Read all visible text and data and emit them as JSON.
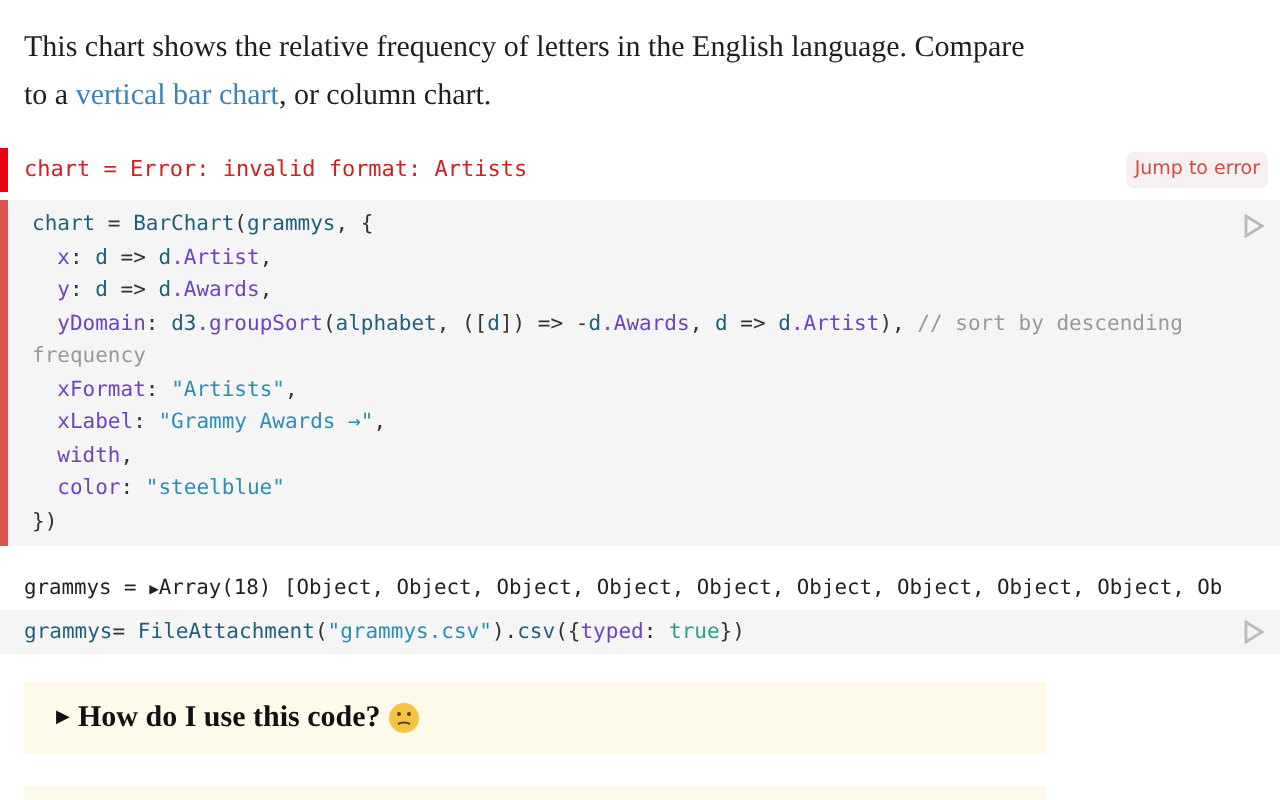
{
  "intro": {
    "text_before": "This chart shows the relative frequency of letters in the English language. Compare to a",
    "link": "vertical bar chart",
    "text_after": ", or column chart."
  },
  "error_cell": {
    "message": "chart = Error: invalid format: Artists",
    "button": "Jump to error"
  },
  "code_cell": {
    "has_error": true,
    "lines": [
      {
        "indent": false,
        "tokens": [
          {
            "kind": "var",
            "text": "chart"
          },
          {
            "kind": "plain",
            "text": " = "
          },
          {
            "kind": "fn",
            "text": "BarChart"
          },
          {
            "kind": "plain",
            "text": "("
          },
          {
            "kind": "fn",
            "text": "grammys"
          },
          {
            "kind": "plain",
            "text": ", {"
          }
        ]
      },
      {
        "indent": true,
        "tokens": [
          {
            "kind": "prop",
            "text": "x"
          },
          {
            "kind": "plain",
            "text": ": "
          },
          {
            "kind": "var",
            "text": "d"
          },
          {
            "kind": "plain",
            "text": " => "
          },
          {
            "kind": "var",
            "text": "d"
          },
          {
            "kind": "prop",
            "text": ".Artist"
          },
          {
            "kind": "plain",
            "text": ","
          }
        ]
      },
      {
        "indent": true,
        "tokens": [
          {
            "kind": "prop",
            "text": "y"
          },
          {
            "kind": "plain",
            "text": ": "
          },
          {
            "kind": "var",
            "text": "d"
          },
          {
            "kind": "plain",
            "text": " => "
          },
          {
            "kind": "var",
            "text": "d"
          },
          {
            "kind": "prop",
            "text": ".Awards"
          },
          {
            "kind": "plain",
            "text": ","
          }
        ]
      },
      {
        "indent": true,
        "tokens": [
          {
            "kind": "prop",
            "text": "yDomain"
          },
          {
            "kind": "plain",
            "text": ": "
          },
          {
            "kind": "var",
            "text": "d3"
          },
          {
            "kind": "prop",
            "text": ".groupSort"
          },
          {
            "kind": "plain",
            "text": "("
          },
          {
            "kind": "var",
            "text": "alphabet"
          },
          {
            "kind": "plain",
            "text": ", (["
          },
          {
            "kind": "var",
            "text": "d"
          },
          {
            "kind": "plain",
            "text": "]) => -"
          },
          {
            "kind": "var",
            "text": "d"
          },
          {
            "kind": "prop",
            "text": ".Awards"
          },
          {
            "kind": "plain",
            "text": ", "
          },
          {
            "kind": "var",
            "text": "d"
          },
          {
            "kind": "plain",
            "text": " => "
          },
          {
            "kind": "var",
            "text": "d"
          },
          {
            "kind": "prop",
            "text": ".Artist"
          },
          {
            "kind": "plain",
            "text": "), "
          },
          {
            "kind": "comment",
            "text": "// sort by descending"
          }
        ]
      },
      {
        "indent": false,
        "tokens": [
          {
            "kind": "comment",
            "text": "frequency"
          }
        ]
      },
      {
        "indent": true,
        "tokens": [
          {
            "kind": "prop",
            "text": "xFormat"
          },
          {
            "kind": "plain",
            "text": ": "
          },
          {
            "kind": "string",
            "text": "\"Artists\""
          },
          {
            "kind": "plain",
            "text": ","
          }
        ]
      },
      {
        "indent": true,
        "tokens": [
          {
            "kind": "prop",
            "text": "xLabel"
          },
          {
            "kind": "plain",
            "text": ": "
          },
          {
            "kind": "string",
            "text": "\"Grammy Awards →\""
          },
          {
            "kind": "plain",
            "text": ","
          }
        ]
      },
      {
        "indent": true,
        "tokens": [
          {
            "kind": "prop",
            "text": "width"
          },
          {
            "kind": "plain",
            "text": ","
          }
        ]
      },
      {
        "indent": true,
        "tokens": [
          {
            "kind": "prop",
            "text": "color"
          },
          {
            "kind": "plain",
            "text": ": "
          },
          {
            "kind": "string",
            "text": "\"steelblue\""
          }
        ]
      },
      {
        "indent": false,
        "tokens": [
          {
            "kind": "plain",
            "text": "})"
          }
        ]
      }
    ]
  },
  "output": {
    "prefix": "grammys = ",
    "toggle": "▶",
    "value": "Array(18) [Object, Object, Object, Object, Object, Object, Object, Object, Object, Ob"
  },
  "data_cell": {
    "lines": [
      {
        "indent": false,
        "tokens": [
          {
            "kind": "var",
            "text": "grammys"
          },
          {
            "kind": "plain",
            "text": "= "
          },
          {
            "kind": "fn",
            "text": "FileAttachment"
          },
          {
            "kind": "plain",
            "text": "("
          },
          {
            "kind": "string",
            "text": "\"grammys.csv\""
          },
          {
            "kind": "plain",
            "text": ")."
          },
          {
            "kind": "fn",
            "text": "csv"
          },
          {
            "kind": "plain",
            "text": "({"
          },
          {
            "kind": "prop",
            "text": "typed"
          },
          {
            "kind": "plain",
            "text": ": "
          },
          {
            "kind": "keyword",
            "text": "true"
          },
          {
            "kind": "plain",
            "text": "})"
          }
        ]
      }
    ]
  },
  "details": {
    "toggle": "▶",
    "summary": "How do I use this code?",
    "expanded": false
  }
}
